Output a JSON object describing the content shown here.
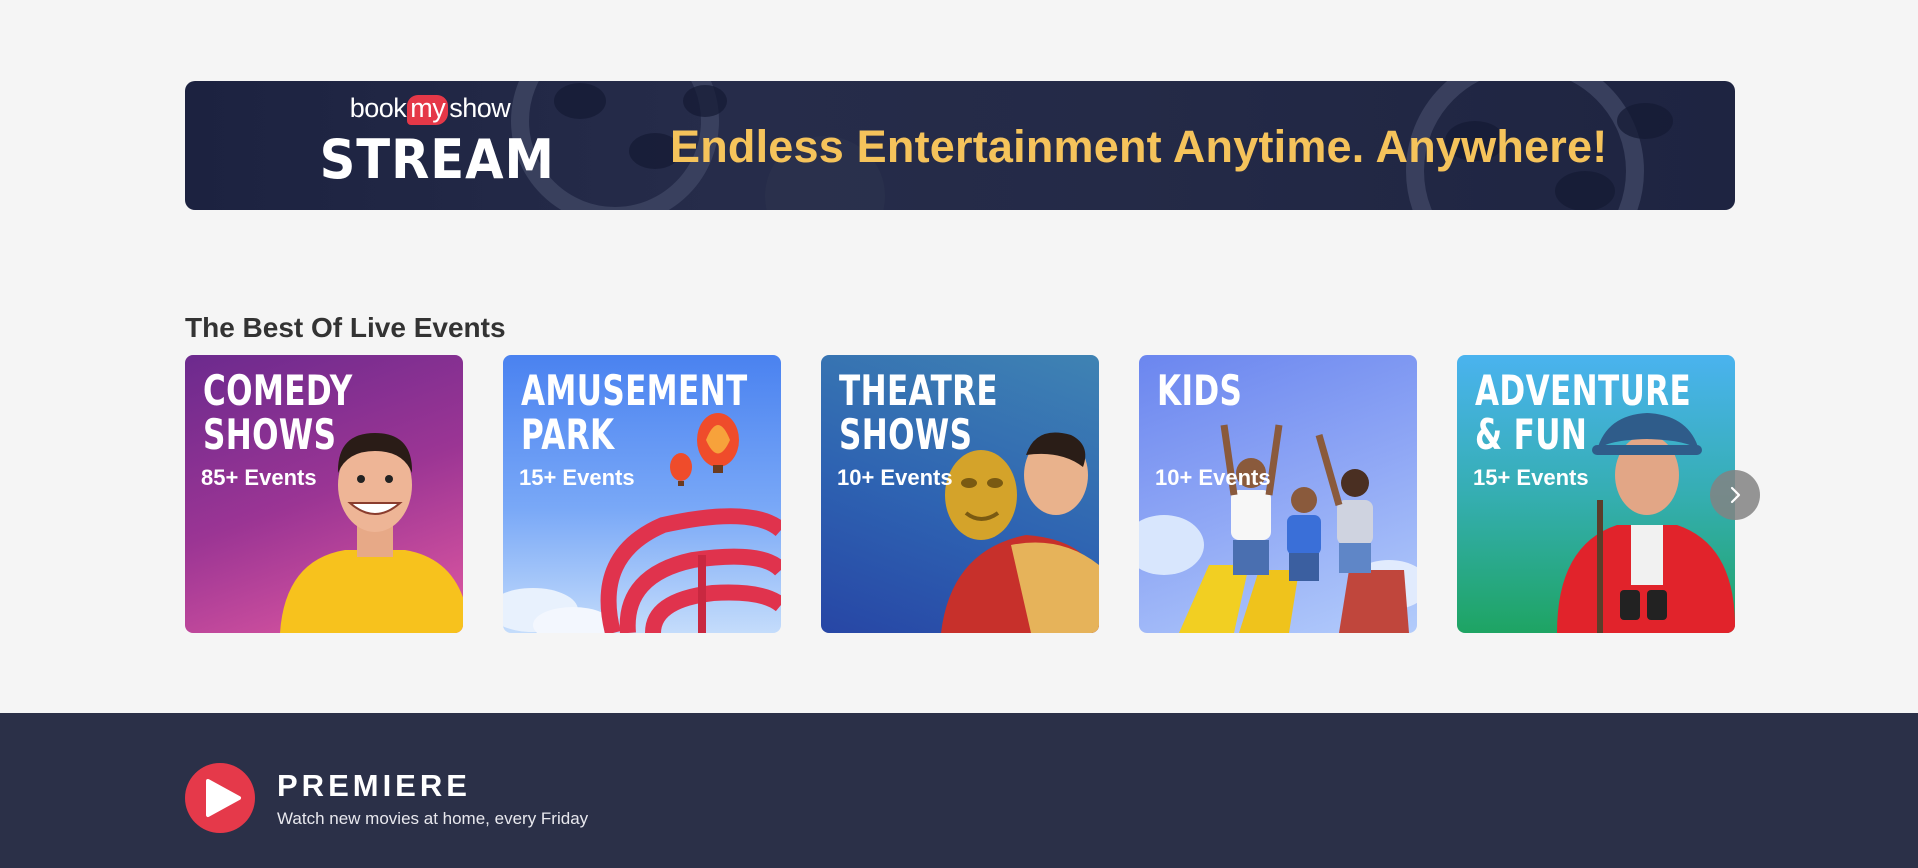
{
  "banner": {
    "brand_prefix": "book",
    "brand_my": "my",
    "brand_suffix": "show",
    "brand_product": "STREAM",
    "tagline": "Endless Entertainment Anytime. Anywhere!",
    "tagline_color": "#f5c35b",
    "icon": "film-reel-icon"
  },
  "live_events": {
    "title": "The Best Of Live Events",
    "cards": [
      {
        "title_line1": "COMEDY",
        "title_line2": "SHOWS",
        "count": "85+ Events",
        "colors": [
          "#7a2a92",
          "#e0559c"
        ]
      },
      {
        "title_line1": "AMUSEMENT",
        "title_line2": "PARK",
        "count": "15+ Events",
        "colors": [
          "#4a7ff0",
          "#bcd6fb"
        ]
      },
      {
        "title_line1": "THEATRE",
        "title_line2": "SHOWS",
        "count": "10+ Events",
        "colors": [
          "#3a6fc0",
          "#2c4ea8"
        ]
      },
      {
        "title_line1": "KIDS",
        "title_line2": "",
        "count": "10+ Events",
        "colors": [
          "#6e8cf2",
          "#a9c4fa"
        ]
      },
      {
        "title_line1": "ADVENTURE",
        "title_line2": "& FUN",
        "count": "15+ Events",
        "colors": [
          "#4aa7e8",
          "#1fa463"
        ]
      }
    ],
    "next_icon": "chevron-right-icon"
  },
  "premiere": {
    "title": "PREMIERE",
    "subtitle": "Watch new movies at home, every Friday",
    "icon": "play-icon",
    "accent": "#e5394a"
  }
}
